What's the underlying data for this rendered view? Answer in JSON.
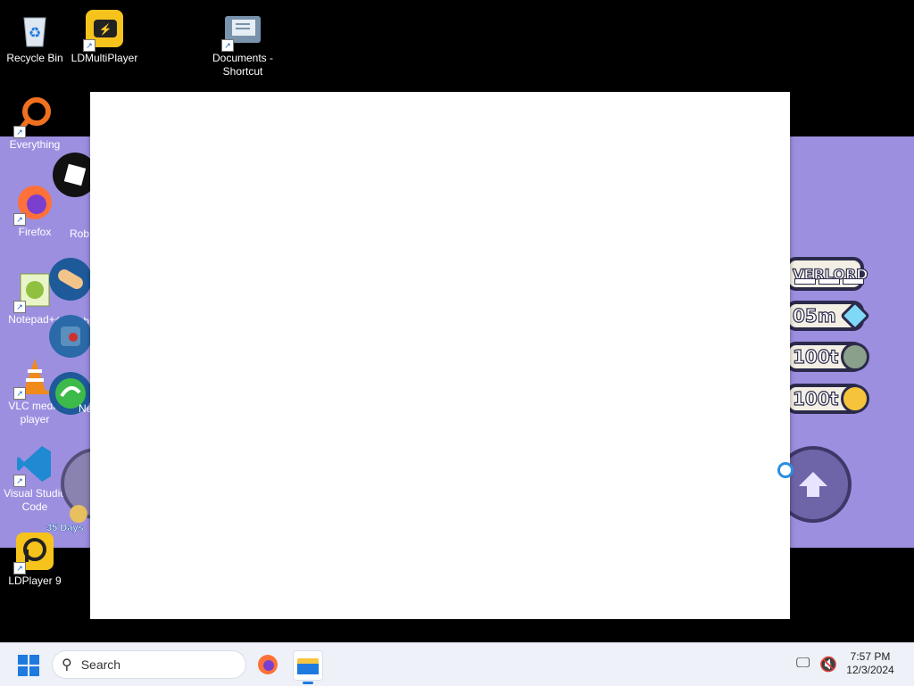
{
  "desktop": {
    "icons": [
      {
        "label": "Recycle Bin"
      },
      {
        "label": "LDMultiPlayer"
      },
      {
        "label": "Documents - Shortcut"
      },
      {
        "label": "Everything"
      },
      {
        "label": "Firefox"
      },
      {
        "label": "Notepad++"
      },
      {
        "label": "VLC media player"
      },
      {
        "label": "Visual Studio Code"
      },
      {
        "label": "LDPlayer 9"
      },
      {
        "label": "Rob"
      },
      {
        "label": "Rob"
      },
      {
        "label": "Ne"
      }
    ]
  },
  "game": {
    "rank_label": "VERLORD",
    "gems": "05m",
    "paws": "100t",
    "coins": "100t",
    "days_badge": "35 Days"
  },
  "taskbar": {
    "search_placeholder": "Search",
    "time": "7:57 PM",
    "date": "12/3/2024"
  },
  "colors": {
    "game_bg": "#9d8fe0",
    "taskbar_bg": "#eef2f8",
    "accent": "#1f7ae0"
  }
}
